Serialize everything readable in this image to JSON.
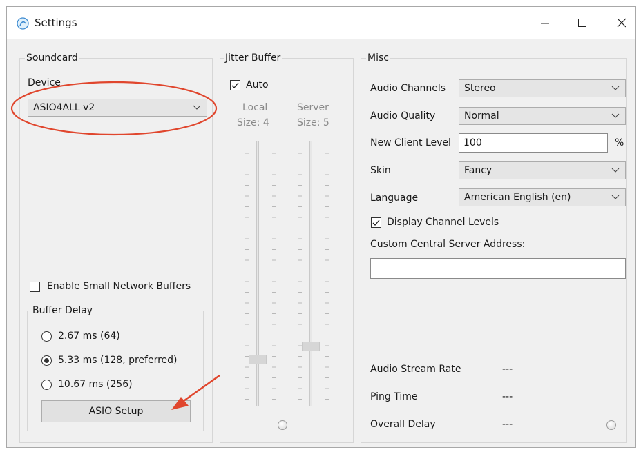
{
  "window": {
    "title": "Settings"
  },
  "soundcard": {
    "group_label": "Soundcard",
    "device_label": "Device",
    "device_value": "ASIO4ALL v2",
    "small_buffers_label": "Enable Small Network Buffers",
    "small_buffers_checked": false,
    "buffer_delay": {
      "group_label": "Buffer Delay",
      "options": [
        {
          "label": "2.67 ms (64)",
          "selected": false
        },
        {
          "label": "5.33 ms (128, preferred)",
          "selected": true
        },
        {
          "label": "10.67 ms (256)",
          "selected": false
        }
      ]
    },
    "asio_setup_label": "ASIO Setup"
  },
  "jitter": {
    "group_label": "Jitter Buffer",
    "auto_label": "Auto",
    "auto_checked": true,
    "local_label": "Local",
    "local_size": "Size: 4",
    "server_label": "Server",
    "server_size": "Size: 5"
  },
  "misc": {
    "group_label": "Misc",
    "audio_channels_label": "Audio Channels",
    "audio_channels_value": "Stereo",
    "audio_quality_label": "Audio Quality",
    "audio_quality_value": "Normal",
    "new_client_level_label": "New Client Level",
    "new_client_level_value": "100",
    "percent_sign": "%",
    "skin_label": "Skin",
    "skin_value": "Fancy",
    "language_label": "Language",
    "language_value": "American English (en)",
    "display_levels_label": "Display Channel Levels",
    "display_levels_checked": true,
    "server_address_label": "Custom Central Server Address:",
    "server_address_value": "",
    "stream_rate_label": "Audio Stream Rate",
    "stream_rate_value": "---",
    "ping_time_label": "Ping Time",
    "ping_time_value": "---",
    "overall_delay_label": "Overall Delay",
    "overall_delay_value": "---"
  },
  "colors": {
    "annotation": "#e0462d",
    "window_bg": "#f0f0f0"
  },
  "icons": [
    "app-icon",
    "minimize-icon",
    "maximize-icon",
    "close-icon",
    "chevron-down-icon",
    "checkmark-icon"
  ]
}
